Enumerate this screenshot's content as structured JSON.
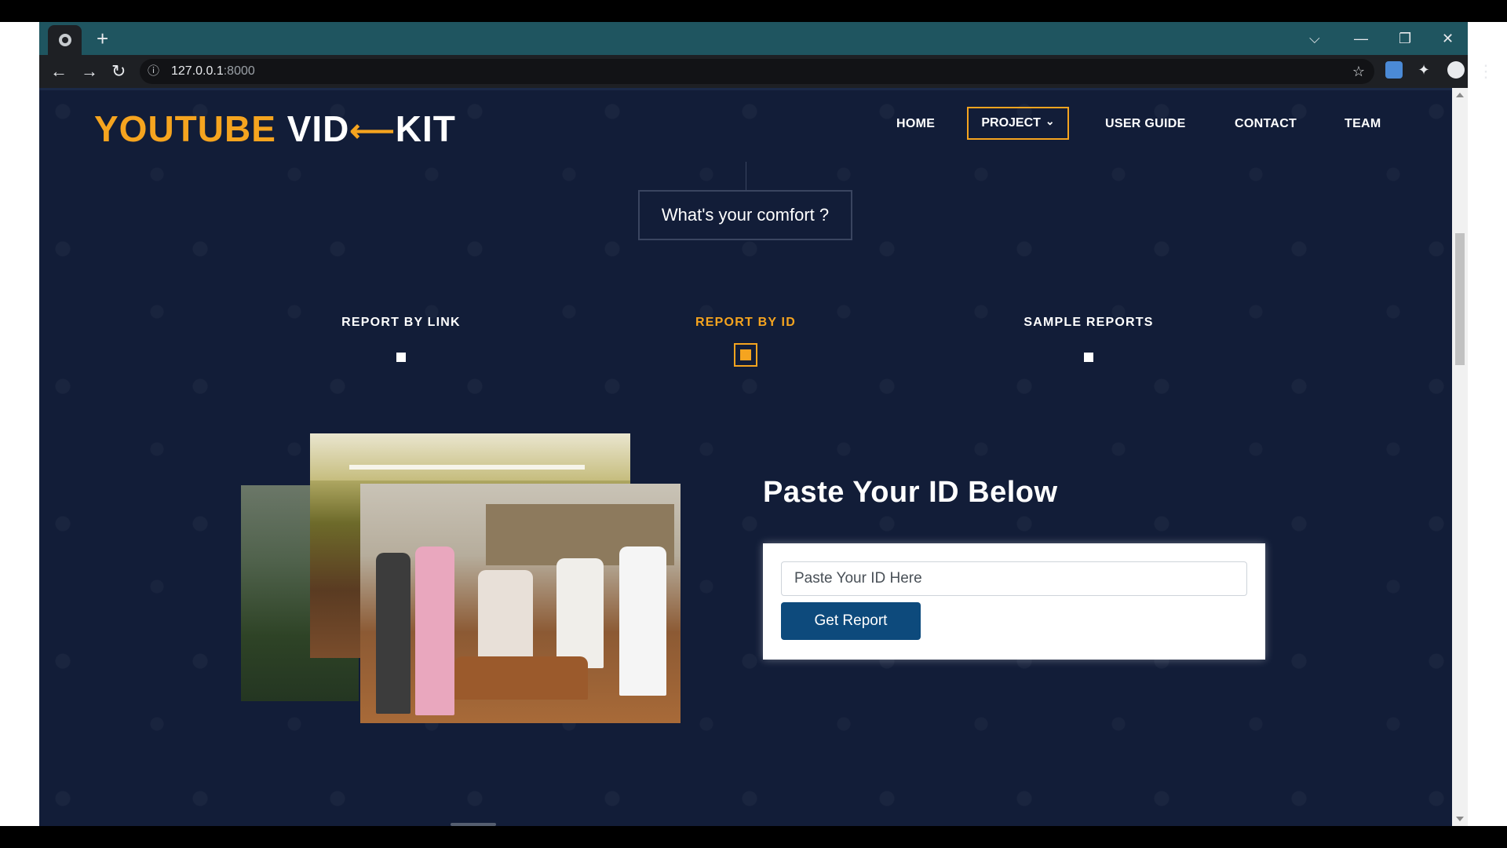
{
  "browser": {
    "new_tab_symbol": "+",
    "url_host": "127.0.0.1",
    "url_port": ":8000",
    "info_symbol": "ⓘ",
    "star_symbol": "☆",
    "back_symbol": "←",
    "forward_symbol": "→",
    "reload_symbol": "↻",
    "menu_symbol": "⋮",
    "tab_list_symbol": "⌵",
    "minimize_symbol": "—",
    "restore_symbol": "❐",
    "close_symbol": "✕"
  },
  "site": {
    "logo": {
      "part1": "YOUTUBE",
      "part2": "VID",
      "arrow": "⟵",
      "part3": "KIT"
    },
    "nav": {
      "home": "HOME",
      "project": "PROJECT",
      "project_caret": "⌄",
      "user_guide": "USER GUIDE",
      "contact": "CONTACT",
      "team": "TEAM"
    },
    "comfort_prompt": "What's your comfort ?",
    "options": [
      {
        "label": "REPORT BY LINK",
        "active": false
      },
      {
        "label": "REPORT BY ID",
        "active": true
      },
      {
        "label": "SAMPLE REPORTS",
        "active": false
      }
    ],
    "report": {
      "title": "Paste Your ID Below",
      "input_placeholder": "Paste Your ID Here",
      "button_label": "Get Report"
    },
    "colors": {
      "accent": "#f5a41f",
      "background": "#121d38",
      "button": "#0d4a7c",
      "browser_tabstrip": "#1f5560"
    }
  }
}
